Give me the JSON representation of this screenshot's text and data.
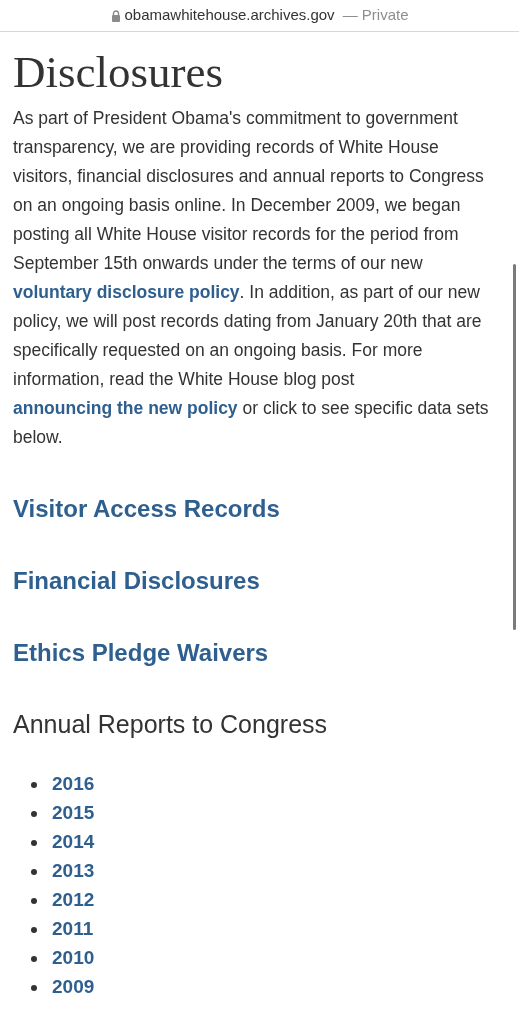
{
  "address_bar": {
    "domain": "obamawhitehouse.archives.gov",
    "suffix": "— Private"
  },
  "title": "Disclosures",
  "intro": [
    {
      "kind": "text",
      "text": "As part of President Obama's commitment to government transparency, we are providing records of White House visitors, financial disclosures and annual reports to Congress on an ongoing basis online. In December 2009, we began posting all White House visitor records for the period from September 15th onwards under the terms of our new "
    },
    {
      "kind": "link",
      "text": "voluntary disclosure policy"
    },
    {
      "kind": "text",
      "text": ". In addition, as part of our new policy, we will post records dating from January 20th that are specifically requested on an ongoing basis. For more information, read the White House blog post "
    },
    {
      "kind": "link",
      "text": "announcing the new policy"
    },
    {
      "kind": "text",
      "text": " or click to see specific data sets below."
    }
  ],
  "section_links": [
    "Visitor Access Records",
    "Financial Disclosures",
    "Ethics Pledge Waivers"
  ],
  "annual_reports": {
    "heading": "Annual Reports to Congress",
    "years": [
      "2016",
      "2015",
      "2014",
      "2013",
      "2012",
      "2011",
      "2010",
      "2009"
    ]
  }
}
